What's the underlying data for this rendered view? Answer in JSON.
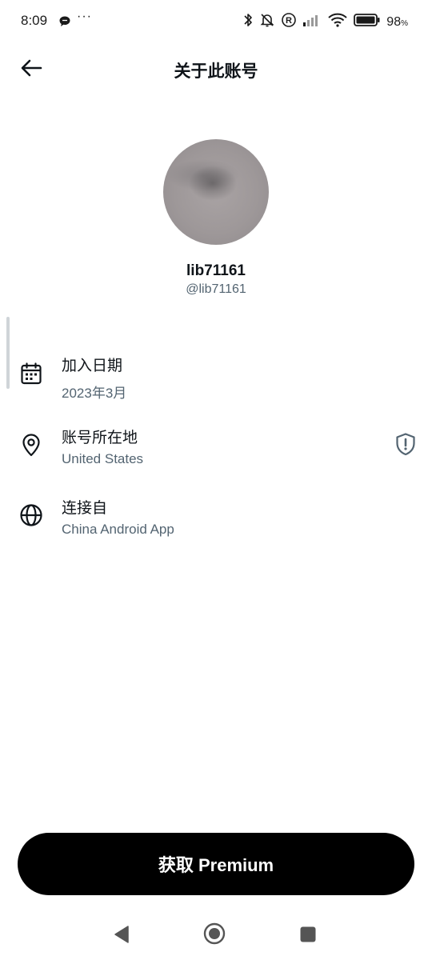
{
  "status_bar": {
    "time": "8:09",
    "more": "···",
    "battery_percent": "98",
    "battery_unit": "%",
    "icons": [
      "chat-bubble-icon",
      "bluetooth-icon",
      "bell-off-icon",
      "registered-icon",
      "signal-icon",
      "wifi-icon",
      "battery-icon"
    ]
  },
  "header": {
    "title": "关于此账号",
    "back_icon": "arrow-left-icon"
  },
  "profile": {
    "display_name": "lib71161",
    "username": "@lib71161"
  },
  "info": [
    {
      "icon": "calendar-icon",
      "label": "加入日期",
      "value": "2023年3月"
    },
    {
      "icon": "location-pin-icon",
      "label": "账号所在地",
      "value": "United States",
      "badge_icon": "shield-alert-icon"
    },
    {
      "icon": "globe-icon",
      "label": "连接自",
      "value": "China Android App"
    }
  ],
  "premium_button": {
    "label": "获取 Premium"
  },
  "nav_bar": {
    "icons": [
      "nav-back-icon",
      "nav-home-icon",
      "nav-recents-icon"
    ]
  },
  "colors": {
    "primary_text": "#0f1419",
    "secondary_text": "#536471",
    "button_bg": "#000000",
    "button_text": "#ffffff",
    "icon_gray": "#536471"
  }
}
